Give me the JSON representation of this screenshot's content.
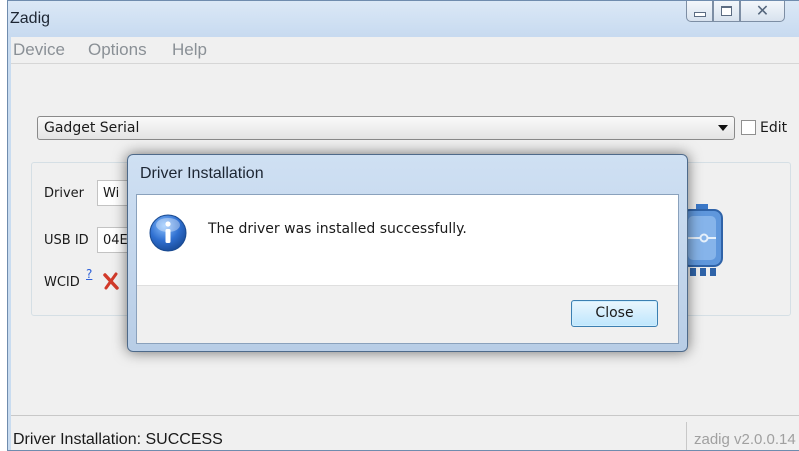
{
  "window": {
    "title": "Zadig",
    "controls": [
      "minimize-icon",
      "maximize-icon",
      "close-icon"
    ]
  },
  "menu": {
    "items": [
      "Device",
      "Options",
      "Help"
    ]
  },
  "device_selector": {
    "selected": "Gadget Serial",
    "edit_label": "Edit",
    "edit_checked": false
  },
  "fields": {
    "driver_label": "Driver",
    "driver_value": "Wi",
    "usb_id_label": "USB ID",
    "usb_id_value": "04E",
    "wcid_label": "WCID",
    "wcid_help": "?",
    "wcid_status_icon": "red-x-icon"
  },
  "statusbar": {
    "status": "Driver Installation: SUCCESS",
    "version": "zadig v2.0.0.14"
  },
  "dialog": {
    "title": "Driver Installation",
    "icon": "info-icon",
    "message": "The driver was installed successfully.",
    "close_label": "Close"
  },
  "colors": {
    "titlebar": "#c9dcf0",
    "dialog_button_border": "#3c7fb1",
    "info_icon": "#2f6fd0",
    "error_x": "#d23a2a",
    "link": "#2b5fd9"
  }
}
